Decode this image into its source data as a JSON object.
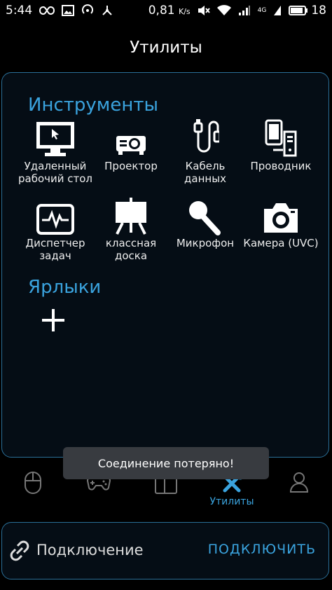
{
  "status": {
    "time": "5:44",
    "speed": "0,81",
    "speed_unit": "K/s",
    "network": "4G",
    "battery": "18"
  },
  "header": {
    "title": "Утилиты"
  },
  "sections": {
    "tools": "Инструменты",
    "shortcuts": "Ярлыки"
  },
  "tools": [
    {
      "label1": "Удаленный",
      "label2": "рабочий стол",
      "icon": "remote-desktop-icon"
    },
    {
      "label1": "Проектор",
      "label2": "",
      "icon": "projector-icon"
    },
    {
      "label1": "Кабель",
      "label2": "данных",
      "icon": "cable-icon"
    },
    {
      "label1": "Проводник",
      "label2": "",
      "icon": "explorer-icon"
    },
    {
      "label1": "Диспетчер",
      "label2": "задач",
      "icon": "task-manager-icon"
    },
    {
      "label1": "классная",
      "label2": "доска",
      "icon": "whiteboard-icon"
    },
    {
      "label1": "Микрофон",
      "label2": "",
      "icon": "microphone-icon"
    },
    {
      "label1": "Камера (UVC)",
      "label2": "",
      "icon": "camera-icon"
    }
  ],
  "toast": {
    "message": "Соединение потеряно!"
  },
  "nav": {
    "active_label": "Утилиты"
  },
  "connection": {
    "title": "Подключение",
    "action": "ПОДКЛЮЧИТЬ"
  },
  "colors": {
    "accent": "#3aa3de",
    "border": "#2a6f98",
    "background": "#000000"
  }
}
